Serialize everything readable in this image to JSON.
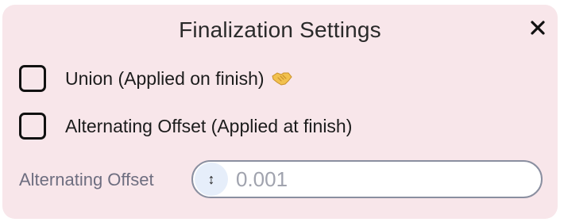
{
  "dialog": {
    "title": "Finalization Settings",
    "close_icon": "close-x-icon"
  },
  "options": [
    {
      "label": "Union (Applied on finish)",
      "icon": "handshake-emoji-icon",
      "checked": false
    },
    {
      "label": "Alternating Offset (Applied at finish)",
      "checked": false
    }
  ],
  "offset_field": {
    "label": "Alternating Offset",
    "value": "",
    "placeholder": "0.001",
    "icon": "up-down-arrow-icon",
    "icon_glyph": "↕"
  },
  "colors": {
    "dialog_background": "#f8e6ea",
    "stepper_background": "#e6eefa"
  }
}
